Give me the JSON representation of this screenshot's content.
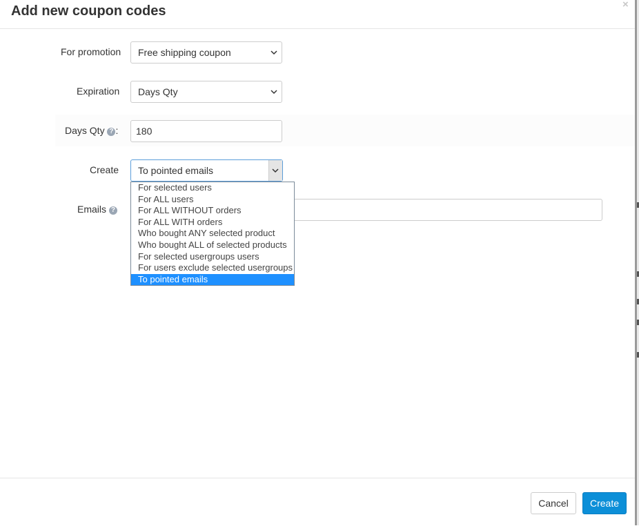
{
  "modal": {
    "title": "Add new coupon codes",
    "close_label": "×"
  },
  "form": {
    "promotion": {
      "label": "For promotion",
      "value": "Free shipping coupon"
    },
    "expiration": {
      "label": "Expiration",
      "value": "Days Qty"
    },
    "days_qty": {
      "label": "Days Qty",
      "label_suffix": ":",
      "value": "180"
    },
    "create": {
      "label": "Create",
      "value": "To pointed emails"
    },
    "emails": {
      "label": "Emails",
      "value": ""
    }
  },
  "dropdown": {
    "options": [
      "For selected users",
      "For ALL users",
      "For ALL WITHOUT orders",
      "For ALL WITH orders",
      "Who bought ANY selected product",
      "Who bought ALL of selected products",
      "For selected usergroups users",
      "For users exclude selected usergroups",
      "To pointed emails"
    ],
    "selected_index": 8
  },
  "footer": {
    "cancel_label": "Cancel",
    "create_label": "Create"
  },
  "colors": {
    "primary": "#0c8fd8",
    "selected_option": "#1e90ff",
    "help_icon": "#9aa6b4"
  },
  "icons": {
    "help": "question-circle-icon",
    "chevron": "chevron-down-icon",
    "close": "close-icon"
  }
}
